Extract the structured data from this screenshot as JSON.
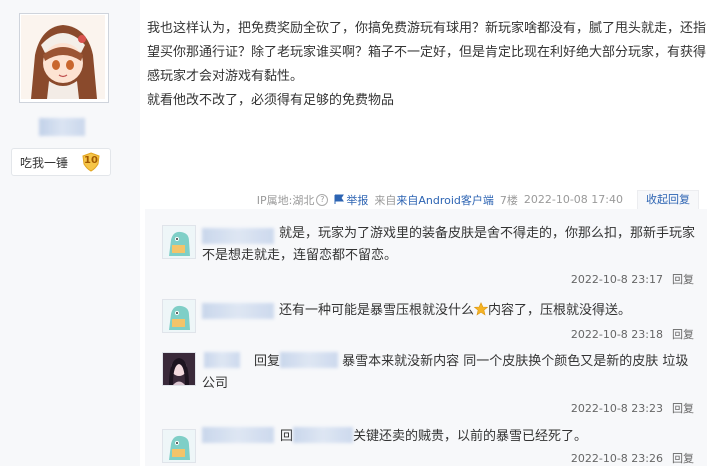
{
  "author": {
    "badge_label": "吃我一锤",
    "level": "10"
  },
  "post": {
    "paragraphs": [
      "我也这样认为，把免费奖励全砍了，你搞免费游玩有球用？新玩家啥都没有，腻了甩头就走，还指望买你那通行证？除了老玩家谁买啊？箱子不一定好，但是肯定比现在利好绝大部分玩家，有获得感玩家才会对游戏有黏性。",
      "就看他改不改了，必须得有足够的免费物品"
    ]
  },
  "tail": {
    "ip": "IP属地:湖北",
    "report": "举报",
    "source": "来自Android客户端",
    "floor": "7楼",
    "time": "2022-10-08 17:40",
    "toggle_reply": "收起回复"
  },
  "replies": [
    {
      "text": "就是，玩家为了游戏里的装备皮肤是舍不得走的，你那么扣，那新手玩家不是想走就走，连留恋都不留恋。",
      "time": "2022-10-8 23:17",
      "reply_label": "回复"
    },
    {
      "text_before": "还有一种可能是暴雪压根就没什么",
      "text_after": "内容了，压根就没得送。",
      "time": "2022-10-8 23:18",
      "reply_label": "回复"
    },
    {
      "prefix": "回复",
      "text": "暴雪本来就没新内容 同一个皮肤换个颜色又是新的皮肤 垃圾公司",
      "time": "2022-10-8 23:23",
      "reply_label": "回复"
    },
    {
      "prefix": "回",
      "text": "关键还卖的贼贵，以前的暴雪已经死了。",
      "time": "2022-10-8 23:26",
      "reply_label": "回复"
    }
  ],
  "colors": {
    "link": "#2d64b3",
    "reply_bg": "#f7f8fa"
  }
}
